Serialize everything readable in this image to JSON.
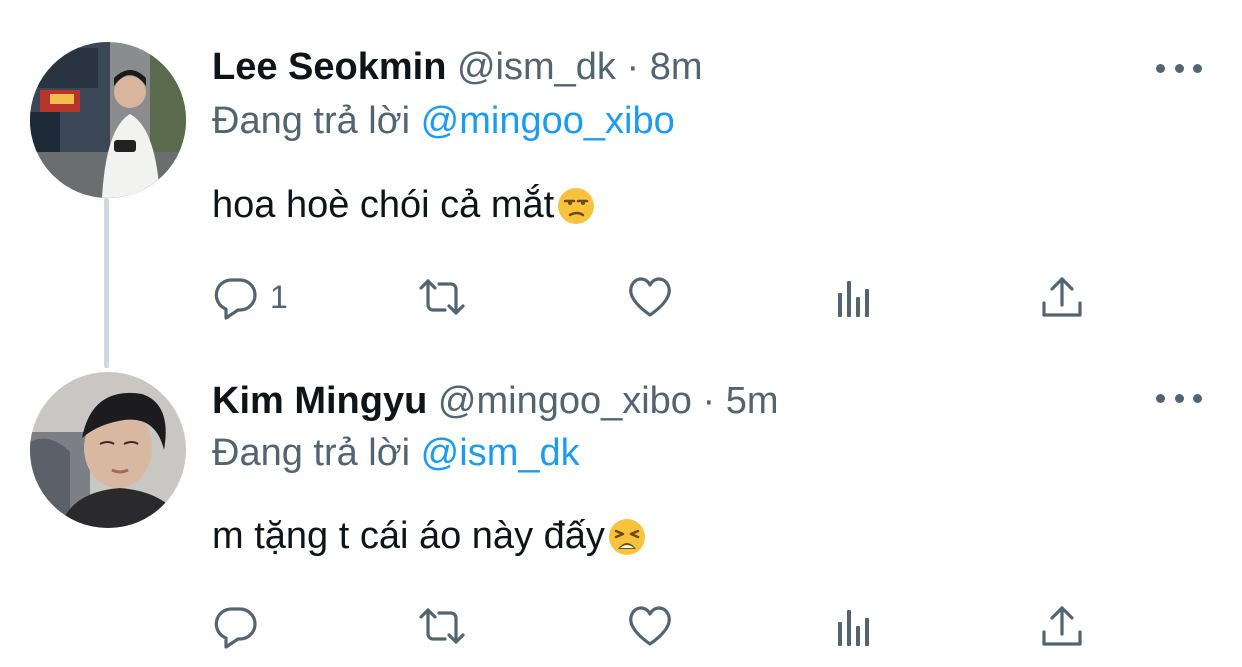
{
  "tweets": [
    {
      "author_name": "Lee Seokmin",
      "handle": "@ism_dk",
      "separator": "·",
      "time": "8m",
      "replying_label": "Đang trả lời",
      "replying_to": "@mingoo_xibo",
      "text": "hoa hoè chói cả mắt",
      "emoji": "unamused-face",
      "reply_count": "1"
    },
    {
      "author_name": "Kim Mingyu",
      "handle": "@mingoo_xibo",
      "separator": "·",
      "time": "5m",
      "replying_label": "Đang trả lời",
      "replying_to": "@ism_dk",
      "text": "m tặng t cái áo này đấy",
      "emoji": "weary-face",
      "reply_count": ""
    }
  ],
  "icons": {
    "reply": "reply-icon",
    "retweet": "retweet-icon",
    "like": "heart-icon",
    "views": "views-icon",
    "share": "share-icon",
    "more": "more-icon"
  },
  "colors": {
    "text": "#0f1419",
    "muted": "#536471",
    "link": "#1d9bf0",
    "thread_line": "#cfd9de"
  }
}
